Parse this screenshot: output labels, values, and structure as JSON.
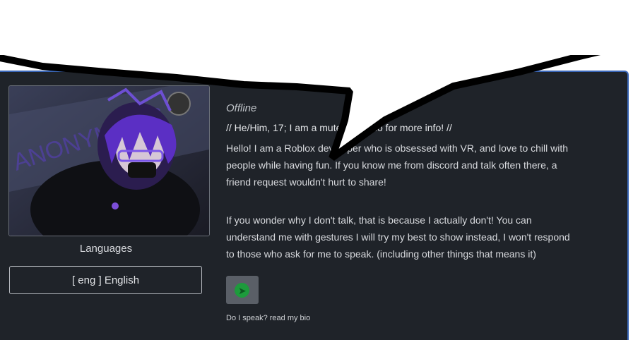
{
  "profile": {
    "status": "Offline",
    "pronouns": "// He/Him, 17; I am a mute, read bio for more info! //",
    "bio_paragraph_1": "Hello! I am a Roblox developer who is obsessed with VR, and love to chill with people while having fun. If you know me from discord and talk often there, a friend request wouldn't hurt to share!",
    "bio_paragraph_2": "If you wonder why I don't talk, that is because I actually don't! You can understand me with gestures I will try my best to show instead, I won't respond to those who ask for me to speak.   (including other things that means it)",
    "note": "Do I speak? read my bio"
  },
  "languages": {
    "label": "Languages",
    "items": [
      {
        "label": "[ eng ] English"
      }
    ]
  },
  "avatar": {
    "background_text": "ANONYMOUS"
  },
  "colors": {
    "panel_bg": "#1f2329",
    "accent_border": "#3a67b8",
    "action_button_bg": "#5a5f67",
    "action_icon": "#1d9b3c"
  },
  "icons": {
    "action_button_icon": "arrow-circle-icon"
  }
}
